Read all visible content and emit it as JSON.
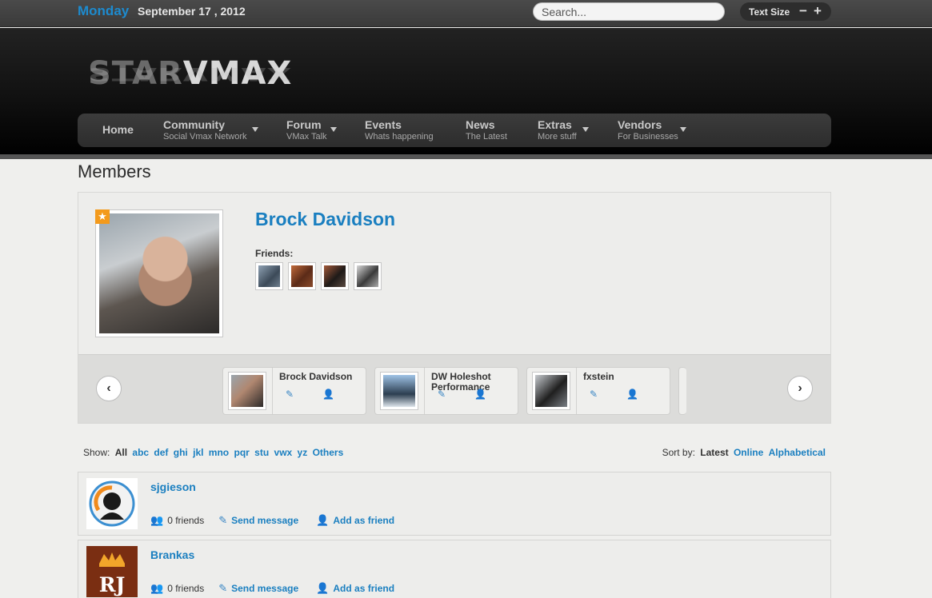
{
  "topbar": {
    "day": "Monday",
    "date": "September 17 , 2012",
    "search_placeholder": "Search...",
    "text_size_label": "Text Size",
    "minus": "−",
    "plus": "+"
  },
  "logo": {
    "part1": "STAR",
    "part2": "VMAX"
  },
  "nav": [
    {
      "title": "Home",
      "subtitle": "",
      "caret": false
    },
    {
      "title": "Community",
      "subtitle": "Social Vmax Network",
      "caret": true
    },
    {
      "title": "Forum",
      "subtitle": "VMax Talk",
      "caret": true
    },
    {
      "title": "Events",
      "subtitle": "Whats happening",
      "caret": false
    },
    {
      "title": "News",
      "subtitle": "The Latest",
      "caret": false
    },
    {
      "title": "Extras",
      "subtitle": "More stuff",
      "caret": true
    },
    {
      "title": "Vendors",
      "subtitle": "For Businesses",
      "caret": true
    }
  ],
  "page_title": "Members",
  "profile": {
    "name": "Brock Davidson",
    "friends_label": "Friends:",
    "star": "★"
  },
  "carousel": {
    "prev": "‹",
    "next": "›",
    "cards": [
      {
        "name": "Brock Davidson"
      },
      {
        "name": "DW Holeshot Performance"
      },
      {
        "name": "fxstein"
      }
    ]
  },
  "filter": {
    "show_label": "Show:",
    "active": "All",
    "options": [
      "abc",
      "def",
      "ghi",
      "jkl",
      "mno",
      "pqr",
      "stu",
      "vwx",
      "yz",
      "Others"
    ]
  },
  "sort": {
    "label": "Sort by:",
    "active": "Latest",
    "options": [
      "Online",
      "Alphabetical"
    ]
  },
  "members": [
    {
      "name": "sjgieson",
      "friends": "0 friends",
      "send": "Send message",
      "add": "Add as friend"
    },
    {
      "name": "Brankas",
      "friends": "0 friends",
      "send": "Send message",
      "add": "Add as friend",
      "avatar_text": "RJ"
    }
  ],
  "colors": {
    "accent": "#1a7fc0",
    "day": "#1d8bcf",
    "star": "#f39a1c"
  }
}
